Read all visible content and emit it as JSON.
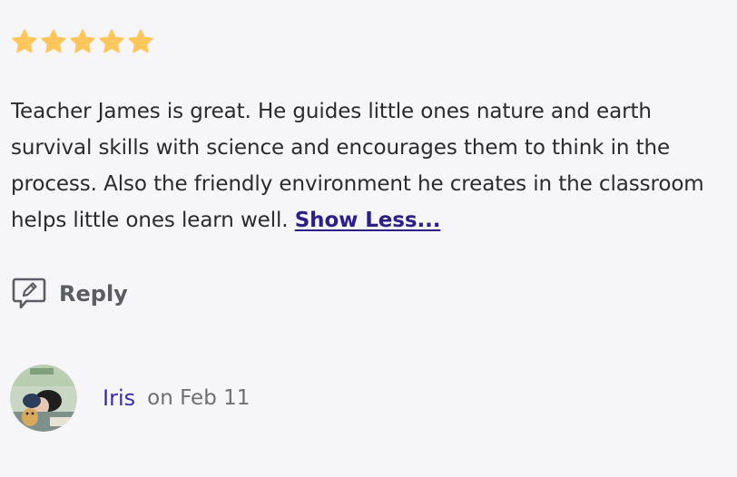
{
  "review": {
    "rating": 5,
    "max_rating": 5,
    "star_color": "#fdc75b",
    "text": "Teacher James is great. He guides little ones nature and earth survival skills with science and encourages them to think in the process.  Also the friendly environment he creates in the classroom helps little ones learn well. ",
    "show_less_label": "Show Less..."
  },
  "actions": {
    "reply_label": "Reply",
    "reply_icon": "edit-message-icon"
  },
  "author": {
    "name": "Iris",
    "date": "on Feb 11",
    "avatar_icon": "avatar-photo",
    "name_color": "#3a2bb3"
  }
}
